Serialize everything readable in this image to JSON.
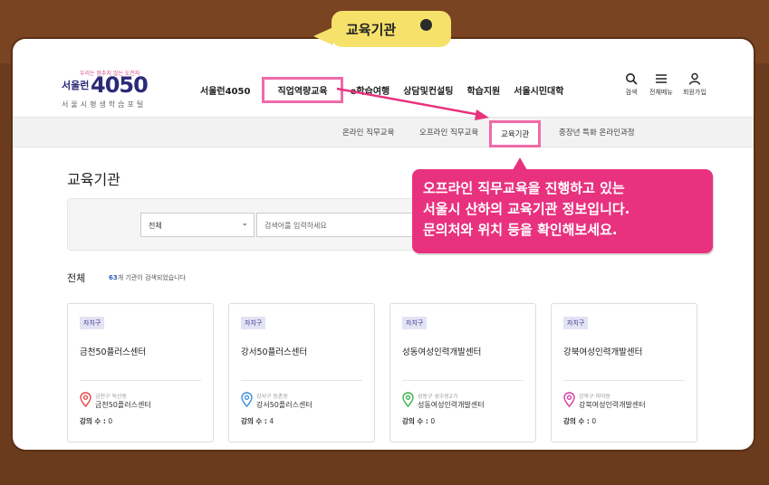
{
  "header": {
    "logo_tagline": "우리는 멈추지 않는 도전자",
    "logo_city": "서울런",
    "logo_number": "4050",
    "logo_subtitle": "서울시평생학습포털",
    "nav": [
      {
        "label": "서울런4050"
      },
      {
        "label": "직업역량교육"
      },
      {
        "label": "e학습여행"
      },
      {
        "label": "상담및컨설팅"
      },
      {
        "label": "학습지원"
      },
      {
        "label": "서울시민대학"
      }
    ],
    "utils": [
      {
        "label": "검색",
        "icon": "search-icon"
      },
      {
        "label": "전체메뉴",
        "icon": "menu-icon"
      },
      {
        "label": "회원가입",
        "icon": "user-icon"
      }
    ]
  },
  "subnav": [
    {
      "label": "온라인 직무교육"
    },
    {
      "label": "오프라인 직무교육"
    },
    {
      "label": "교육기관"
    },
    {
      "label": "중장년 특화 온라인과정"
    }
  ],
  "page": {
    "title": "교육기관",
    "select_value": "전체",
    "search_placeholder": "검색어를 입력하세요",
    "result_label": "전체",
    "result_count_number": "63",
    "result_count_suffix": "개 기관이 검색되었습니다"
  },
  "cards": [
    {
      "badge": "자치구",
      "name": "금천50플러스센터",
      "addr": "금천구 독산동",
      "place": "금천50플러스센터",
      "count_label": "강의 수 :",
      "count": "0",
      "pin_color": "#e84545"
    },
    {
      "badge": "자치구",
      "name": "강서50플러스센터",
      "addr": "강서구 등촌동",
      "place": "강서50플러스센터",
      "count_label": "강의 수 :",
      "count": "4",
      "pin_color": "#3b8fd9"
    },
    {
      "badge": "자치구",
      "name": "성동여성인력개발센터",
      "addr": "성동구 성수동2가",
      "place": "성동여성인력개발센터",
      "count_label": "강의 수 :",
      "count": "0",
      "pin_color": "#3cb44a"
    },
    {
      "badge": "자치구",
      "name": "강북여성인력개발센터",
      "addr": "강북구 미아동",
      "place": "강북여성인력개발센터",
      "count_label": "강의 수 :",
      "count": "0",
      "pin_color": "#d63ca0"
    }
  ],
  "annotation": {
    "tag": "교육기관",
    "callout_lines": [
      "오프라인 직무교육을 진행하고 있는",
      "서울시 산하의 교육기관 정보입니다.",
      "문의처와 위치 등을 확인해보세요."
    ],
    "accent_color": "#e8327f",
    "tag_color": "#f6e16a"
  }
}
